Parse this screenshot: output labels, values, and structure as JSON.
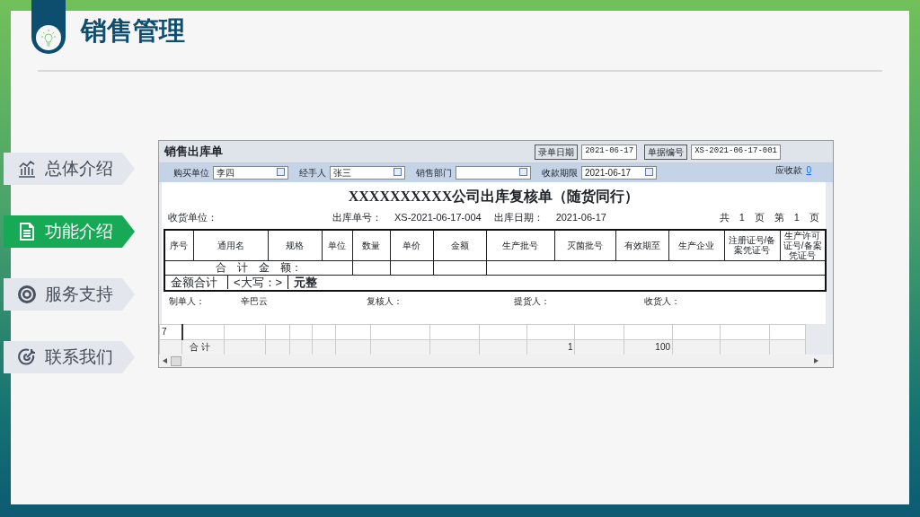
{
  "slide": {
    "title": "销售管理"
  },
  "nav": [
    {
      "label": "总体介绍",
      "selected": false,
      "kind": "chart"
    },
    {
      "label": "功能介绍",
      "selected": true,
      "kind": "document"
    },
    {
      "label": "服务支持",
      "selected": false,
      "kind": "target"
    },
    {
      "label": "联系我们",
      "selected": false,
      "kind": "dart"
    }
  ],
  "window": {
    "title": "销售出库单",
    "header_fields": [
      {
        "label": "录单日期",
        "value": "2021-06-17"
      },
      {
        "label": "单据编号",
        "value": "XS-2021-06-17-001"
      }
    ],
    "filter_fields": [
      {
        "label": "购买单位",
        "value": "李四"
      },
      {
        "label": "经手人",
        "value": "张三"
      },
      {
        "label": "销售部门"
      },
      {
        "label": "收款期限",
        "value": "2021-06-17"
      }
    ],
    "receivable": {
      "label": "应收款",
      "value": "0"
    }
  },
  "report": {
    "title": "XXXXXXXXXX公司出库复核单（随货同行）",
    "info": [
      {
        "kind": "left",
        "text": "收货单位："
      },
      {
        "kind": "mid",
        "text": "出库单号："
      },
      {
        "kind": "mid",
        "text": "XS-2021-06-17-004"
      },
      {
        "kind": "mid",
        "text": "出库日期："
      },
      {
        "kind": "mid",
        "text": "2021-06-17"
      },
      {
        "kind": "right",
        "text": "共　1　页　第　1　页"
      }
    ],
    "columns": [
      "序号",
      "通用名",
      "规格",
      "单位",
      "数量",
      "单价",
      "金额",
      "生产批号",
      "灭菌批号",
      "有效期至",
      "生产企业",
      "注册证号/备案凭证号",
      "生产许可证号/备案凭证号"
    ],
    "total_label": "合　计　金　额：",
    "amount_row": [
      "金额合计",
      "<大写：>",
      "元整"
    ],
    "signatures": [
      "制单人：",
      "辛巴云",
      "复核人：",
      "提货人：",
      "收货人："
    ]
  },
  "grid": {
    "row_label": "7",
    "total_cells": [
      {
        "kind": "label",
        "text": "合  计"
      },
      {
        "kind": "blank"
      },
      {
        "kind": "blank"
      },
      {
        "kind": "blank"
      },
      {
        "kind": "blank"
      },
      {
        "kind": "blank"
      },
      {
        "kind": "blank"
      },
      {
        "kind": "blank"
      },
      {
        "kind": "blank"
      },
      {
        "kind": "value",
        "text": "1"
      },
      {
        "kind": "blank"
      },
      {
        "kind": "value",
        "text": "100"
      },
      {
        "kind": "blank"
      },
      {
        "kind": "blank"
      },
      {
        "kind": "blank"
      }
    ]
  }
}
